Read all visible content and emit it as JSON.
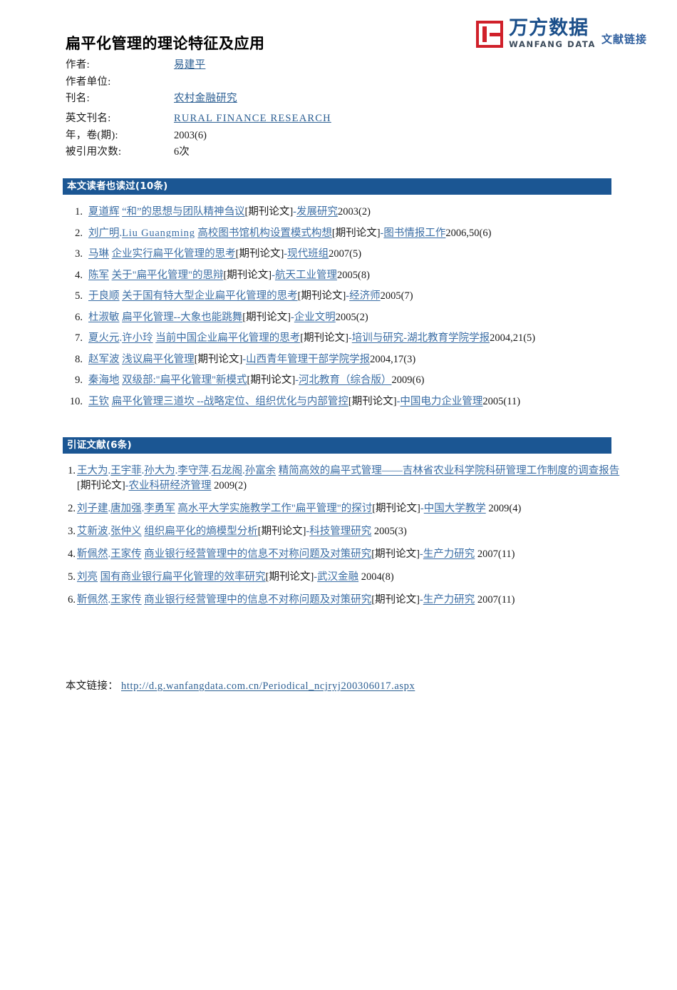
{
  "logo": {
    "mark": "wanfang-square-logo-icon",
    "cn_name": "万方数据",
    "en_name": "WANFANG DATA",
    "sub_label": "文献链接",
    "red": "#d0202a",
    "blue": "#1b4f8a"
  },
  "title": "扁平化管理的理论特征及应用",
  "metadata": [
    {
      "label": "作者:",
      "value": "易建平",
      "is_link": true,
      "style": "cn"
    },
    {
      "label": "作者单位:",
      "value": "",
      "is_link": false,
      "style": "cn"
    },
    {
      "label": "刊名:",
      "value": "农村金融研究",
      "is_link": true,
      "style": "cn"
    },
    {
      "label": "英文刊名:",
      "value": "RURAL  FINANCE  RESEARCH",
      "is_link": true,
      "style": "mono"
    },
    {
      "label": "年，卷(期):",
      "value": "2003(6)",
      "is_link": false,
      "style": "cn"
    },
    {
      "label": "被引用次数:",
      "value": "6次",
      "is_link": false,
      "style": "cn"
    }
  ],
  "readers_section": {
    "bar_title": "本文读者也读过(10条)",
    "accent": "#1b5693",
    "items": [
      {
        "num": "1.",
        "authors": [
          "夏道辉"
        ],
        "title": "“和”的思想与团队精神刍议",
        "type": "[期刊论文]",
        "journal": "发展研究",
        "year_issue": "2003(2)"
      },
      {
        "num": "2.",
        "authors": [
          "刘广明",
          "Liu Guangming"
        ],
        "title": "高校图书馆机构设置模式构想",
        "type": "[期刊论文]",
        "journal": "图书情报工作",
        "year_issue": "2006,50(6)"
      },
      {
        "num": "3.",
        "authors": [
          "马琳"
        ],
        "title": "企业实行扁平化管理的思考",
        "type": "[期刊论文]",
        "journal": "现代班组",
        "year_issue": "2007(5)"
      },
      {
        "num": "4.",
        "authors": [
          "陈军"
        ],
        "title": "关于\"扁平化管理\"的思辩",
        "type": "[期刊论文]",
        "journal": "航天工业管理",
        "year_issue": "2005(8)"
      },
      {
        "num": "5.",
        "authors": [
          "于良顺"
        ],
        "title": "关于国有特大型企业扁平化管理的思考",
        "type": "[期刊论文]",
        "journal": "经济师",
        "year_issue": "2005(7)"
      },
      {
        "num": "6.",
        "authors": [
          "杜淑敏"
        ],
        "title": "扁平化管理--大象也能跳舞",
        "type": "[期刊论文]",
        "journal": "企业文明",
        "year_issue": "2005(2)"
      },
      {
        "num": "7.",
        "authors": [
          "夏火元",
          "许小玲"
        ],
        "title": "当前中国企业扁平化管理的思考",
        "type": "[期刊论文]",
        "journal": "培训与研究-湖北教育学院学报",
        "year_issue": "2004,21(5)"
      },
      {
        "num": "8.",
        "authors": [
          "赵军波"
        ],
        "title": "浅议扁平化管理",
        "type": "[期刊论文]",
        "journal": "山西青年管理干部学院学报",
        "year_issue": "2004,17(3)"
      },
      {
        "num": "9.",
        "authors": [
          "秦海地"
        ],
        "title": "双级部:\"扁平化管理\"新模式",
        "type": "[期刊论文]",
        "journal": "河北教育（综合版）",
        "year_issue": "2009(6)"
      },
      {
        "num": "10.",
        "authors": [
          "王钦"
        ],
        "title": "扁平化管理三道坎 --战略定位、组织优化与内部管控",
        "type": "[期刊论文]",
        "journal": "中国电力企业管理",
        "year_issue": "2005(11)"
      }
    ]
  },
  "citations_section": {
    "bar_title": "引证文献(6条)",
    "accent": "#1b5693",
    "items": [
      {
        "num": "1.",
        "authors": [
          "王大为",
          "王宇菲",
          "孙大为",
          "李守萍",
          "石龙阁",
          "孙富余"
        ],
        "title": "精简高效的扁平式管理——吉林省农业科学院科研管理工作制度的调查报告",
        "type": "[期刊论文]",
        "journal": "农业科研经济管理",
        "year_issue": "2009(2)"
      },
      {
        "num": "2.",
        "authors": [
          "刘子建",
          "唐加强",
          "李勇军"
        ],
        "title": "高水平大学实施教学工作\"扁平管理\"的探讨",
        "type": "[期刊论文]",
        "journal": "中国大学教学",
        "year_issue": "2009(4)"
      },
      {
        "num": "3.",
        "authors": [
          "艾新波",
          "张仲义"
        ],
        "title": "组织扁平化的熵模型分析",
        "type": "[期刊论文]",
        "journal": "科技管理研究",
        "year_issue": "2005(3)"
      },
      {
        "num": "4.",
        "authors": [
          "靳佩然",
          "王家传"
        ],
        "title": "商业银行经营管理中的信息不对称问题及对策研究",
        "type": "[期刊论文]",
        "journal": "生产力研究",
        "year_issue": "2007(11)"
      },
      {
        "num": "5.",
        "authors": [
          "刘亮"
        ],
        "title": "国有商业银行扁平化管理的效率研究",
        "type": "[期刊论文]",
        "journal": "武汉金融",
        "year_issue": "2004(8)"
      },
      {
        "num": "6.",
        "authors": [
          "靳佩然",
          "王家传"
        ],
        "title": "商业银行经营管理中的信息不对称问题及对策研究",
        "type": "[期刊论文]",
        "journal": "生产力研究",
        "year_issue": "2007(11)"
      }
    ]
  },
  "bottom_link": {
    "label": "本文链接：",
    "url": "http://d.g.wanfangdata.com.cn/Periodical_ncjryj200306017.aspx"
  }
}
